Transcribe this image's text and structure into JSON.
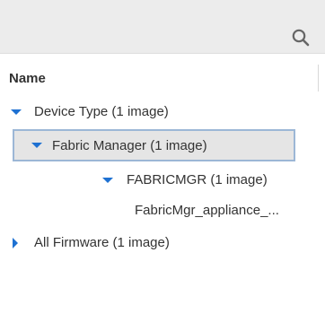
{
  "search": {
    "icon": "search-icon"
  },
  "column_header": {
    "name_label": "Name"
  },
  "tree": {
    "items": [
      {
        "label": "Device Type (1 image)",
        "expanded": true,
        "level": 0
      },
      {
        "label": "Fabric Manager (1 image)",
        "expanded": true,
        "level": 1,
        "selected": true
      },
      {
        "label": "FABRICMGR (1 image)",
        "expanded": true,
        "level": 2
      },
      {
        "label": "FabricMgr_appliance_...",
        "level": 3
      },
      {
        "label": "All Firmware (1 image)",
        "expanded": false,
        "level": 0
      }
    ]
  },
  "colors": {
    "caret": "#1e71d2",
    "selection_fill": "#e5e5e5",
    "selection_border": "#9cb7d6",
    "toolbar_bg": "#ececec"
  }
}
